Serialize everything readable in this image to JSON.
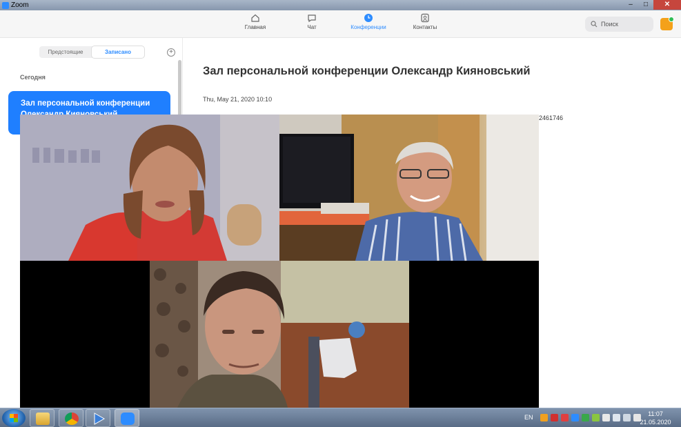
{
  "window": {
    "title": "Zoom",
    "minimize": "–",
    "maximize": "□",
    "close": "✕"
  },
  "nav": {
    "items": [
      {
        "label": "Главная",
        "icon": "home-icon"
      },
      {
        "label": "Чат",
        "icon": "chat-icon"
      },
      {
        "label": "Конференции",
        "icon": "clock-icon",
        "active": true
      },
      {
        "label": "Контакты",
        "icon": "contacts-icon"
      }
    ],
    "search_placeholder": "Поиск"
  },
  "sidebar": {
    "tabs": [
      "Предстоящие",
      "Записано"
    ],
    "active_tab": "Записано",
    "add_label": "+",
    "section": "Сегодня",
    "meeting_title": "Зал персональной конференции Олександр Кияновський"
  },
  "main": {
    "title": "Зал персональной конференции Олександр Кияновський",
    "date": "Thu, May 21, 2020 10:10",
    "meeting_id_partial": "2461746"
  },
  "taskbar": {
    "lang": "EN",
    "time": "11:07",
    "date": "21.05.2020"
  },
  "colors": {
    "accent": "#2d8cff",
    "card": "#1f7fff"
  }
}
